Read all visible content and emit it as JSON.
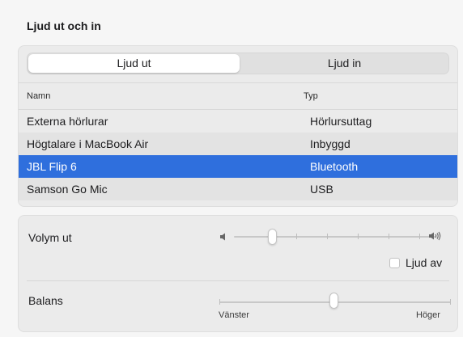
{
  "section": {
    "title": "Ljud ut och in"
  },
  "segmented": {
    "tabs": [
      "Ljud ut",
      "Ljud in"
    ],
    "selected": "Ljud ut"
  },
  "table": {
    "columns": [
      "Namn",
      "Typ"
    ],
    "rows": [
      [
        "Externa hörlurar",
        "Hörlursuttag"
      ],
      [
        "Högtalare i MacBook Air",
        "Inbyggd"
      ],
      [
        "JBL Flip 6",
        "Bluetooth"
      ],
      [
        "Samson Go Mic",
        "USB"
      ]
    ],
    "selected_row": 2
  },
  "volume": {
    "label": "Volym ut",
    "level": 0.2
  },
  "mute": {
    "label": "Ljud av",
    "checked": false
  },
  "balance": {
    "label": "Balans",
    "left_label": "Vänster",
    "right_label": "Höger",
    "value": 0.5
  },
  "colors": {
    "accent": "#2f6fdd",
    "panel": "#ebebeb",
    "background": "#f6f6f6"
  },
  "icons": [
    "speaker-low-icon",
    "speaker-high-icon"
  ]
}
